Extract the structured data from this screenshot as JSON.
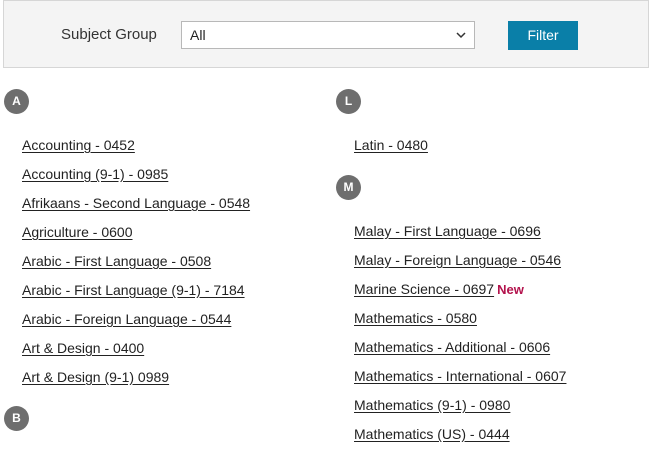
{
  "filter": {
    "label": "Subject Group",
    "selected": "All",
    "button": "Filter"
  },
  "sections": {
    "a": {
      "letter": "A",
      "items": [
        "Accounting - 0452",
        "Accounting (9-1) - 0985",
        "Afrikaans - Second Language - 0548",
        "Agriculture - 0600",
        "Arabic - First Language - 0508",
        "Arabic - First Language (9-1) - 7184",
        "Arabic - Foreign Language - 0544",
        "Art & Design - 0400",
        "Art & Design (9-1) 0989"
      ]
    },
    "b": {
      "letter": "B"
    },
    "l": {
      "letter": "L",
      "items": [
        "Latin - 0480"
      ]
    },
    "m": {
      "letter": "M",
      "items": [
        "Malay - First Language - 0696",
        "Malay - Foreign Language - 0546",
        "Marine Science - 0697",
        "Mathematics - 0580",
        "Mathematics - Additional - 0606",
        "Mathematics - International - 0607",
        "Mathematics (9-1) - 0980",
        "Mathematics (US) - 0444"
      ],
      "new_label": "New"
    }
  }
}
